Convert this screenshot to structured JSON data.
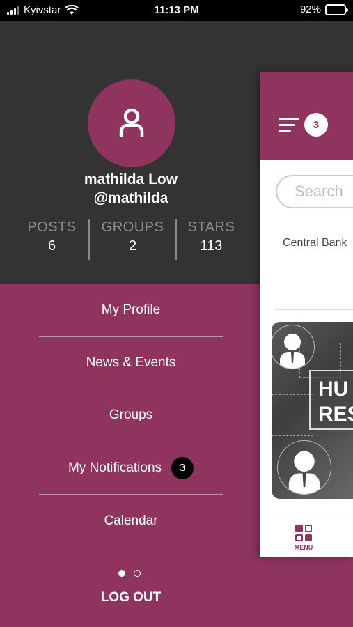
{
  "status_bar": {
    "carrier": "Kyivstar",
    "time": "11:13 PM",
    "battery": "92%",
    "battery_level": 0.92
  },
  "profile": {
    "name": "mathilda Low",
    "handle": "@mathilda"
  },
  "stats": [
    {
      "label": "POSTS",
      "value": "6"
    },
    {
      "label": "GROUPS",
      "value": "2"
    },
    {
      "label": "STARS",
      "value": "113"
    }
  ],
  "menu": {
    "items": [
      {
        "label": "My Profile"
      },
      {
        "label": "News & Events"
      },
      {
        "label": "Groups"
      },
      {
        "label": "My Notifications",
        "badge": "3"
      },
      {
        "label": "Calendar"
      }
    ],
    "logout": "LOG OUT"
  },
  "pager": {
    "pages": 2,
    "current": 1
  },
  "panel": {
    "header_badge": "3",
    "search_placeholder": "Search",
    "bank_label": "Central Bank",
    "image_text_line1": "HU",
    "image_text_line2": "RES",
    "bottom_tab_label": "MENU"
  },
  "colors": {
    "accent": "#8e345f",
    "dark": "#333333",
    "black": "#000000"
  }
}
